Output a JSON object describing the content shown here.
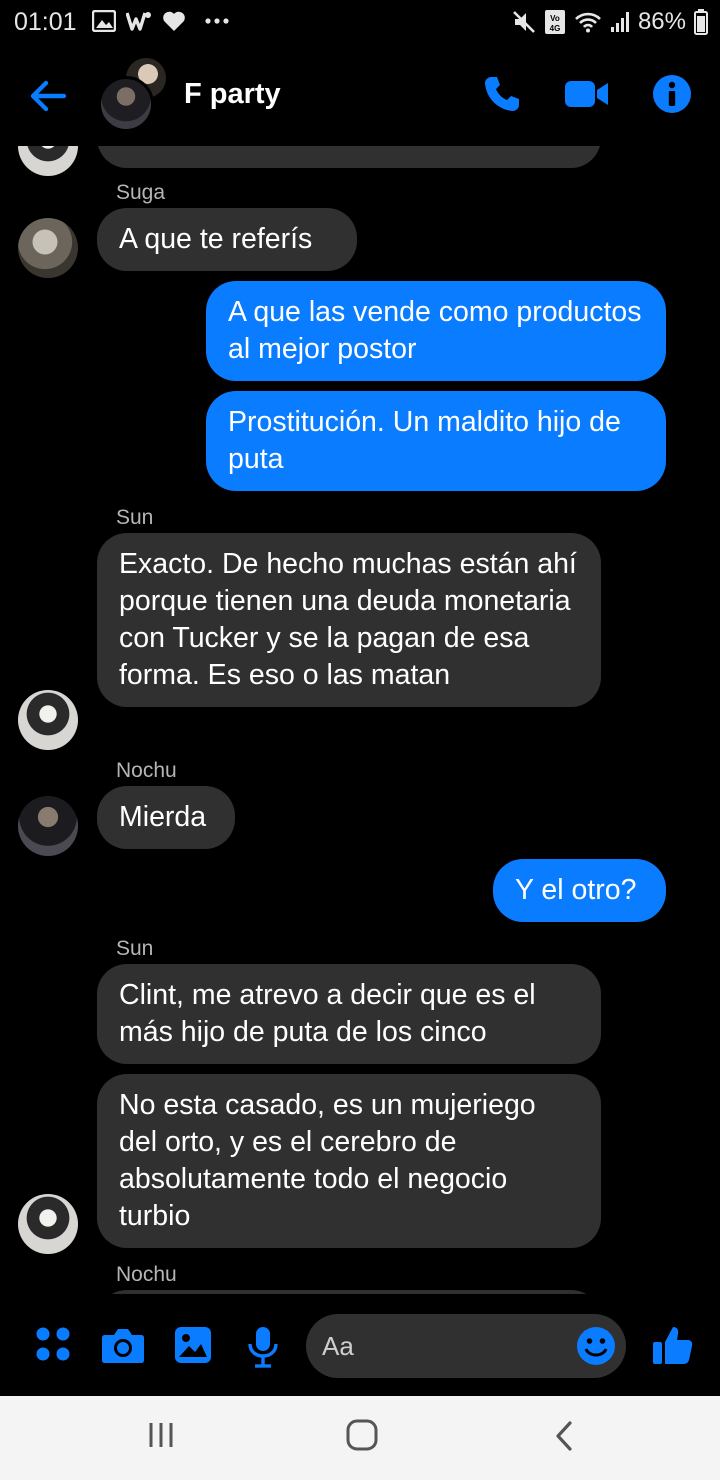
{
  "status_bar": {
    "time": "01:01",
    "battery_percent": "86%",
    "icons": [
      "gallery-icon",
      "w-app-icon",
      "heart-icon",
      "more-icon",
      "mute-icon",
      "volte-4g-icon",
      "wifi-icon",
      "signal-icon",
      "battery-icon"
    ]
  },
  "header": {
    "title": "F party",
    "icons": [
      "back-arrow-icon",
      "phone-icon",
      "video-icon",
      "info-icon"
    ],
    "accent_color": "#0a7cff"
  },
  "messages": [
    {
      "sender": "Suga",
      "direction": "in",
      "text": "A que te referís"
    },
    {
      "direction": "out",
      "text": "A que las vende como productos al mejor postor"
    },
    {
      "direction": "out",
      "text": "Prostitución. Un maldito hijo de puta"
    },
    {
      "sender": "Sun",
      "direction": "in",
      "text": "Exacto. De hecho muchas están ahí porque tienen una deuda monetaria con Tucker y se la pagan de esa forma. Es eso o las matan"
    },
    {
      "sender": "Nochu",
      "direction": "in",
      "text": "Mierda"
    },
    {
      "direction": "out",
      "text": "Y el otro?"
    },
    {
      "sender": "Sun",
      "direction": "in",
      "text": "Clint, me atrevo a decir que es el más hijo de puta de los cinco"
    },
    {
      "direction": "in",
      "text": "No esta casado, es un mujeriego del orto, y es el cerebro de absolutamente todo el negocio turbio"
    },
    {
      "sender": "Nochu",
      "direction": "in",
      "text": ""
    }
  ],
  "composer": {
    "placeholder": "Aa",
    "icons": [
      "apps-icon",
      "camera-icon",
      "image-icon",
      "microphone-icon",
      "emoji-icon",
      "thumbs-up-icon"
    ]
  },
  "nav_bar": {
    "icons": [
      "recent-apps-icon",
      "home-icon",
      "back-icon"
    ]
  }
}
